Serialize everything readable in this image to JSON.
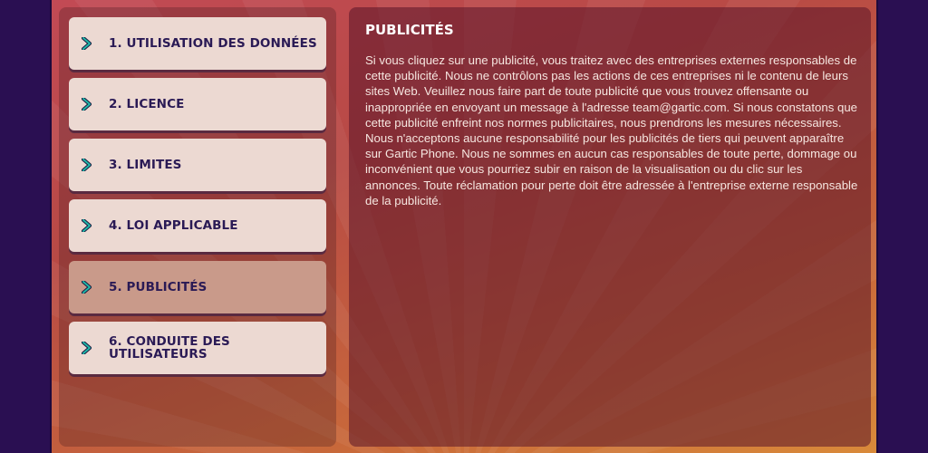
{
  "menu": {
    "items": [
      {
        "label": "1. UTILISATION DES DONNÉES",
        "active": false,
        "icon": "chevron-right-icon"
      },
      {
        "label": "2. LICENCE",
        "active": false,
        "icon": "chevron-right-icon"
      },
      {
        "label": "3. LIMITES",
        "active": false,
        "icon": "chevron-right-icon"
      },
      {
        "label": "4. LOI APPLICABLE",
        "active": false,
        "icon": "chevron-right-icon"
      },
      {
        "label": "5. PUBLICITÉS",
        "active": true,
        "icon": "chevron-right-icon"
      },
      {
        "label": "6. CONDUITE DES UTILISATEURS",
        "active": false,
        "icon": "chevron-right-icon"
      }
    ]
  },
  "content": {
    "title": "PUBLICITÉS",
    "body": "Si vous cliquez sur une publicité, vous traitez avec des entreprises externes responsables de cette publicité. Nous ne contrôlons pas les actions de ces entreprises ni le contenu de leurs sites Web. Veuillez nous faire part de toute publicité que vous trouvez offensante ou inappropriée en envoyant un message à l'adresse team@gartic.com. Si nous constatons que cette publicité enfreint nos normes publicitaires, nous prendrons les mesures nécessaires. Nous n'acceptons aucune responsabilité pour les publicités de tiers qui peuvent apparaître sur Gartic Phone. Nous ne sommes en aucun cas responsables de toute perte, dommage ou inconvénient que vous pourriez subir en raison de la visualisation ou du clic sur les annonces. Toute réclamation pour perte doit être adressée à l'entreprise externe responsable de la publicité."
  },
  "colors": {
    "background": "#2a0f52",
    "menu_item": "#ecd9d2",
    "menu_item_active": "#c99a8a",
    "menu_text": "#2a1a55",
    "chevron": "#1fb7a8"
  }
}
